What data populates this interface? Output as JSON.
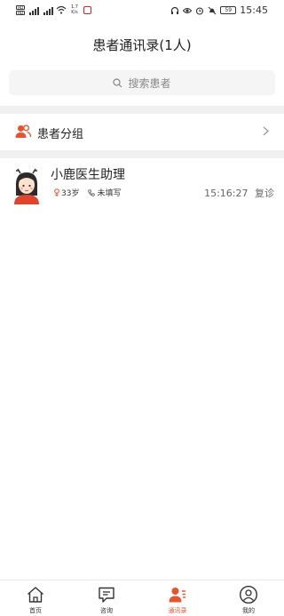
{
  "status_bar": {
    "network_speed_value": "1.7",
    "network_speed_unit": "K/s",
    "time": "15:45",
    "battery": "59",
    "sim1_label": "HD",
    "sim2_label": "HD"
  },
  "header": {
    "title": "患者通讯录(1人)"
  },
  "search": {
    "placeholder": "搜索患者"
  },
  "group": {
    "label": "患者分组"
  },
  "patients": [
    {
      "name": "小鹿医生助理",
      "age": "33岁",
      "phone": "未填写",
      "time": "15:16:27",
      "status": "复诊"
    }
  ],
  "tabbar": {
    "items": [
      {
        "label": "首页",
        "icon": "home-icon"
      },
      {
        "label": "咨询",
        "icon": "chat-icon"
      },
      {
        "label": "通讯录",
        "icon": "contacts-icon"
      },
      {
        "label": "我的",
        "icon": "profile-icon"
      }
    ]
  },
  "colors": {
    "accent": "#e8532c",
    "text": "#222222",
    "muted": "#888888",
    "divider": "#f0f0f0"
  }
}
